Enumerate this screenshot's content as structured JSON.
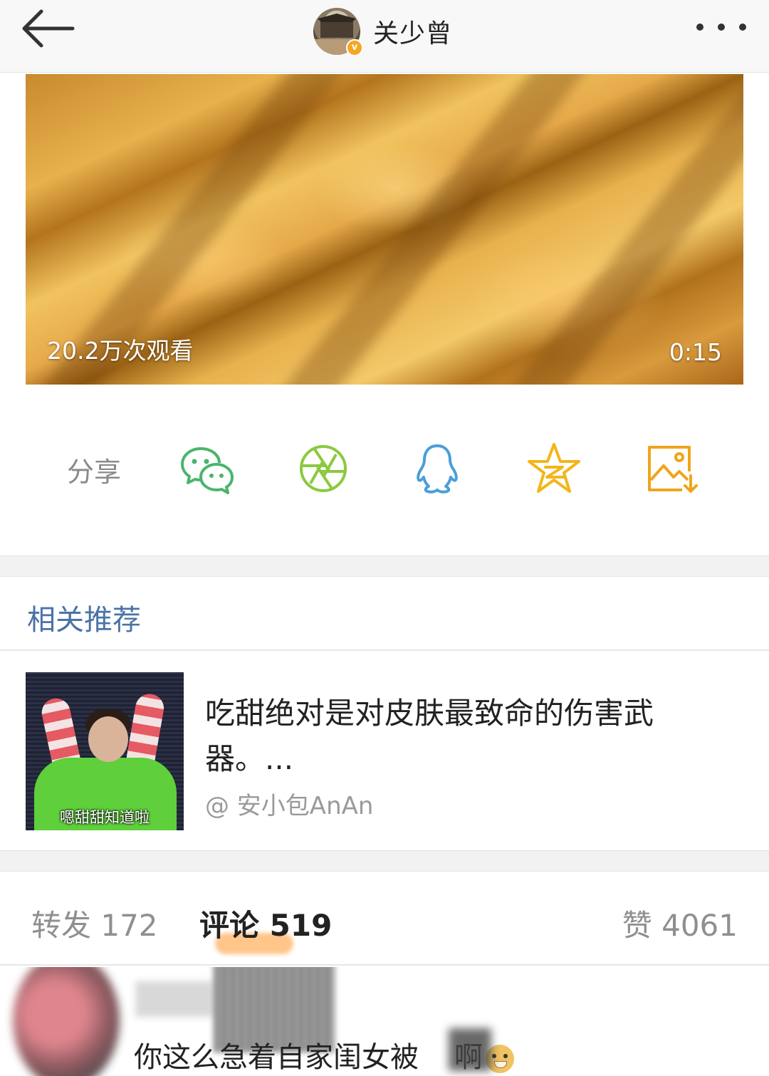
{
  "header": {
    "username": "关少曾",
    "back_icon": "arrow-left-icon",
    "more_icon": "more-dots-icon",
    "verified_badge": "v"
  },
  "video": {
    "views": "20.2万次观看",
    "duration": "0:15"
  },
  "share": {
    "label": "分享",
    "targets": [
      "wechat-icon",
      "moments-icon",
      "qq-icon",
      "qzone-icon",
      "save-image-icon"
    ],
    "colors": {
      "wechat": "#49b56b",
      "moments": "#8cc93f",
      "qq": "#4a9fd8",
      "qzone": "#f2b619",
      "save": "#f0a41c"
    }
  },
  "recommend": {
    "title": "相关推荐",
    "item": {
      "text": "吃甜绝对是对皮肤最致命的伤害武器。...",
      "author": "@ 安小包AnAn",
      "thumb_caption": "嗯甜甜知道啦"
    }
  },
  "tabs": {
    "repost": "转发 172",
    "comments": "评论 519",
    "likes": "赞 4061",
    "active": "comments"
  },
  "comment": {
    "text_part1": "你这么急着自家闺女被",
    "text_part2": "啊",
    "emoji": "doge-emoji"
  },
  "colors": {
    "link_blue": "#4a73a6",
    "tab_underline": "#ff9628"
  }
}
